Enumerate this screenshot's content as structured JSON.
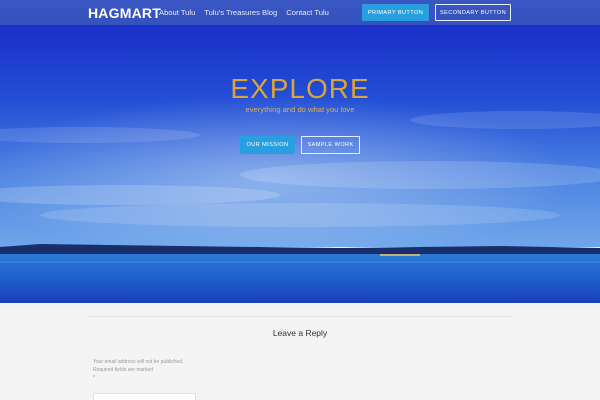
{
  "header": {
    "brand": "HAGMART",
    "nav": [
      "About Tulu",
      "Tulu's Treasures Blog",
      "Contact Tulu"
    ],
    "primary_button": "PRIMARY BUTTON",
    "secondary_button": "SECONDARY BUTTON"
  },
  "hero": {
    "title": "EXPLORE",
    "subtitle": "everything and do what you love",
    "mission_button": "OUR MISSION",
    "sample_button": "SAMPLE WORK"
  },
  "comments": {
    "title": "Leave a Reply",
    "email_note": "Your email address will not be published.",
    "required_note": "Required fields are marked",
    "required_star": "*"
  },
  "colors": {
    "header": "#3451bd",
    "accent_button": "#2a9fe0",
    "hero_title": "#d9a53a"
  }
}
